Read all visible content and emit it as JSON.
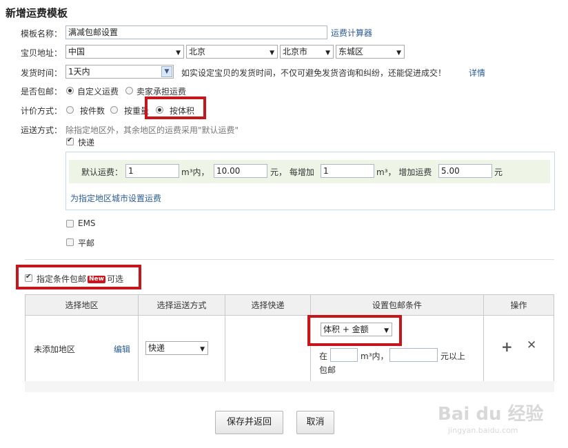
{
  "title": "新增运费模板",
  "template_name": {
    "label": "模板名称：",
    "value": "满减包邮设置",
    "calc_link": "运费计算器"
  },
  "address": {
    "label": "宝贝地址：",
    "country": "中国",
    "province": "北京",
    "city": "北京市",
    "district": "东城区"
  },
  "ship_time": {
    "label": "发货时间：",
    "value": "1天内",
    "hint": "如实设定宝贝的发货时间，不仅可避免发货咨询和纠纷，还能促进成交！",
    "detail_link": "详情"
  },
  "free_shipping": {
    "label": "是否包邮：",
    "opt_custom": "自定义运费",
    "opt_seller": "卖家承担运费"
  },
  "pricing": {
    "label": "计价方式：",
    "opt_count": "按件数",
    "opt_weight": "按重量",
    "opt_volume": "按体积"
  },
  "delivery": {
    "label": "运送方式：",
    "hint": "除指定地区外，其余地区的运费采用\"默认运费\"",
    "express_label": "快递",
    "default_fee_label": "默认运费：",
    "first_volume": "1",
    "unit_within": "m³内，",
    "first_fee": "10.00",
    "yuan_each": "元，  每增加",
    "add_volume": "1",
    "unit_add": "m³，  增加运费",
    "add_fee": "5.00",
    "yuan": "元",
    "region_link": "为指定地区城市设置运费",
    "ems_label": "EMS",
    "post_label": "平邮"
  },
  "conditional": {
    "label": "指定条件包邮",
    "badge": "New",
    "optional": "可选",
    "headers": [
      "选择地区",
      "选择运送方式",
      "选择快递",
      "设置包邮条件",
      "操作"
    ],
    "row": {
      "region": "未添加地区",
      "edit": "编辑",
      "method": "快递",
      "condition": "体积 + 金额",
      "in_label": "在",
      "unit_volume": "m³内，",
      "yuan_above": "元以上",
      "free_label": "包邮",
      "add_icon": "+",
      "remove_icon": "✕"
    }
  },
  "buttons": {
    "save": "保存并返回",
    "cancel": "取消"
  },
  "watermark": {
    "brand": "Bai du 经验",
    "url": "jingyan.baidu.com"
  },
  "colors": {
    "highlight": "#c7161b",
    "link": "#2a5d94",
    "badge": "#d0121b"
  }
}
